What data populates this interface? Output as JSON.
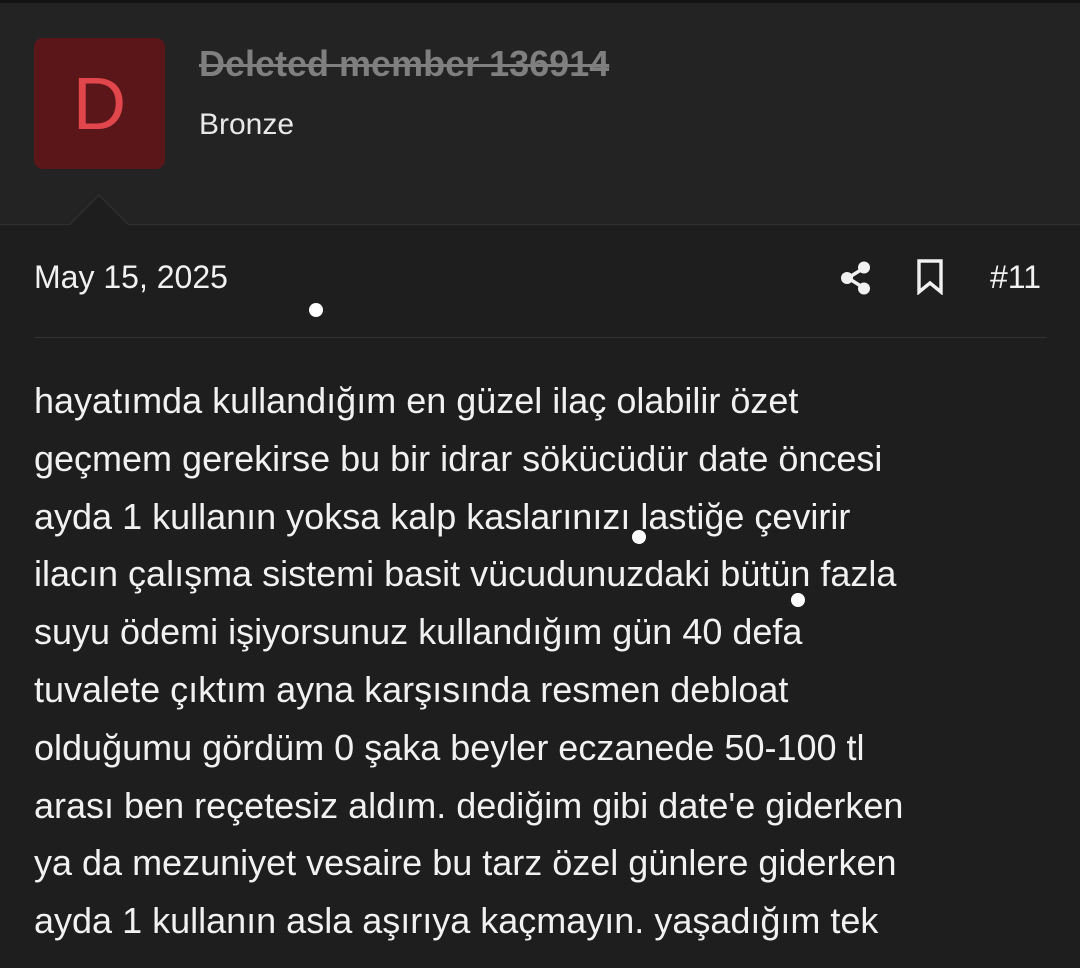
{
  "user": {
    "avatar_letter": "D",
    "name": "Deleted member 136914",
    "title": "Bronze"
  },
  "post": {
    "date": "May 15, 2025",
    "number": "#11",
    "icons": {
      "share": "share-icon",
      "bookmark": "bookmark-icon"
    },
    "lines": [
      "hayatımda kullandığım en güzel ilaç olabilir özet",
      "geçmem gerekirse bu bir idrar sökücüdür date öncesi",
      "ayda 1 kullanın yoksa kalp kaslarınızı lastiğe çevirir",
      "ilacın çalışma sistemi basit vücudunuzdaki bütün fazla",
      "suyu ödemi işiyorsunuz kullandığım gün 40 defa",
      "tuvalete çıktım ayna karşısında resmen debloat",
      "olduğumu gördüm 0 şaka beyler eczanede 50-100 tl",
      "arası ben reçetesiz aldım. dediğim gibi date'e giderken",
      "ya da mezuniyet vesaire bu tarz özel günlere giderken",
      "ayda 1 kullanın asla aşırıya kaçmayın. yaşadığım tek"
    ]
  },
  "colors": {
    "background": "#1e1e1e",
    "header_background": "#232323",
    "avatar_background": "#5a1619",
    "avatar_letter": "#e0464c",
    "username_deleted": "#7f7f7f",
    "text": "#f1f1f1"
  }
}
